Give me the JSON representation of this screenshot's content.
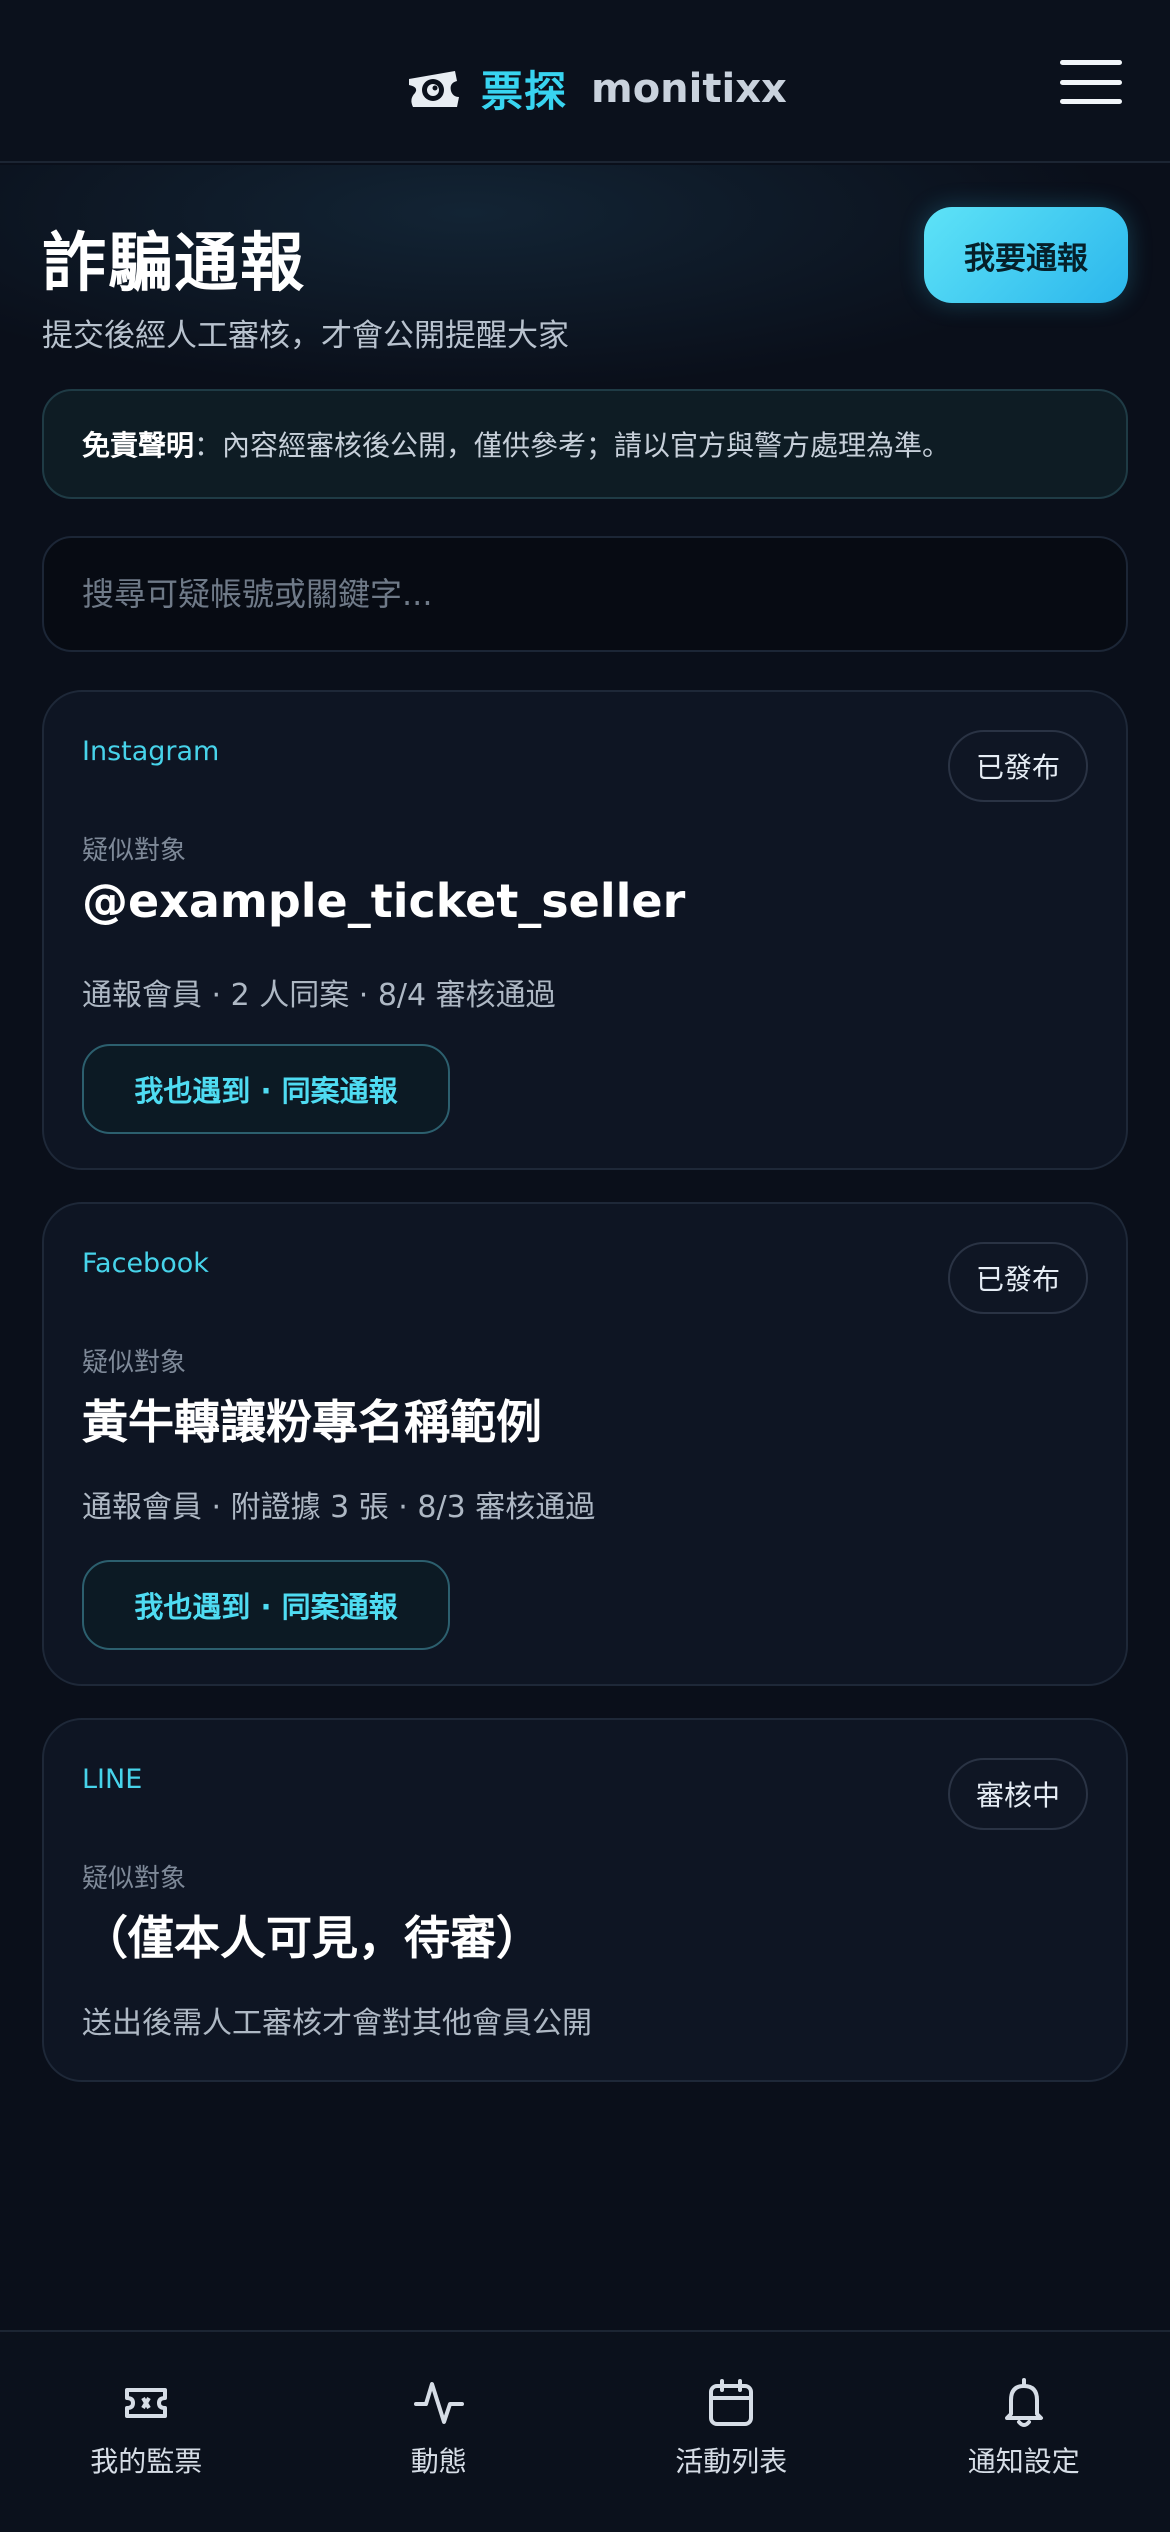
{
  "header": {
    "brand_cn": "票探",
    "brand_en": "monitixx"
  },
  "page": {
    "title": "詐騙通報",
    "subtitle": "提交後經人工審核，才會公開提醒大家",
    "report_button": "我要通報",
    "disclaimer_label": "免責聲明",
    "disclaimer_text": "：內容經審核後公開，僅供參考；請以官方與警方處理為準。",
    "search_placeholder": "搜尋可疑帳號或關鍵字..."
  },
  "cards": [
    {
      "platform": "Instagram",
      "status": "已發布",
      "label": "疑似對象",
      "target": "@example_ticket_seller",
      "meta": "通報會員 · 2 人同案 · 8/4 審核通過",
      "action": "我也遇到 · 同案通報"
    },
    {
      "platform": "Facebook",
      "status": "已發布",
      "label": "疑似對象",
      "target": "黃牛轉讓粉專名稱範例",
      "meta": "通報會員 · 附證據 3 張 · 8/3 審核通過",
      "action": "我也遇到 · 同案通報"
    },
    {
      "platform": "LINE",
      "status": "審核中",
      "label": "疑似對象",
      "target": "（僅本人可見，待審）",
      "meta": "送出後需人工審核才會對其他會員公開"
    }
  ],
  "nav": {
    "items": [
      {
        "label": "我的監票",
        "icon": "ticket-icon"
      },
      {
        "label": "動態",
        "icon": "activity-icon"
      },
      {
        "label": "活動列表",
        "icon": "calendar-icon"
      },
      {
        "label": "通知設定",
        "icon": "bell-icon"
      }
    ]
  },
  "colors": {
    "accent": "#38d4f0",
    "background": "#0a0f1a",
    "card": "#0e1523"
  }
}
